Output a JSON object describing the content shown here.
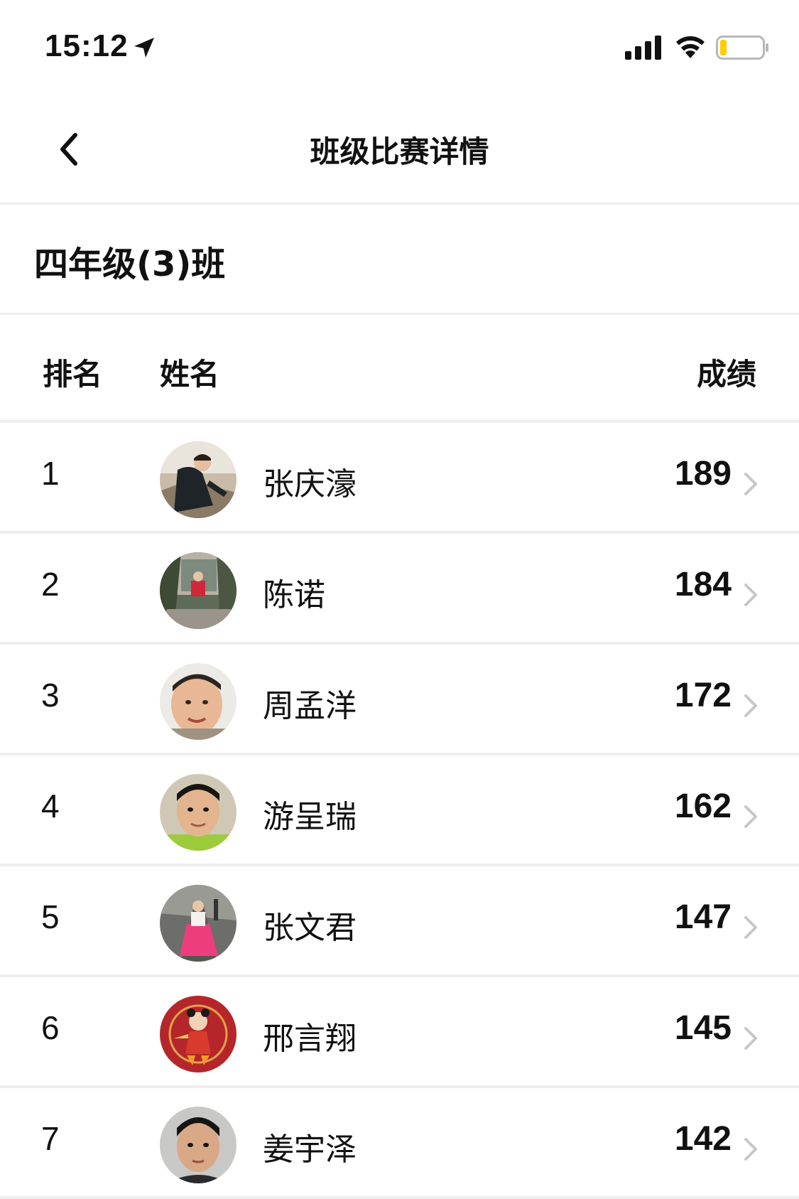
{
  "status_bar": {
    "time": "15:12",
    "icons": [
      "location-arrow-icon",
      "signal-icon",
      "wifi-icon",
      "battery-icon"
    ],
    "battery_level_fraction": 0.15,
    "battery_color": "#ffcc00"
  },
  "nav": {
    "title": "班级比赛详情",
    "back_icon": "chevron-left-icon"
  },
  "class_name": "四年级(3)班",
  "table": {
    "headers": {
      "rank": "排名",
      "name": "姓名",
      "score": "成绩"
    },
    "rows": [
      {
        "rank": "1",
        "name": "张庆濠",
        "score": "189",
        "avatar": "photo-boy-outdoors"
      },
      {
        "rank": "2",
        "name": "陈诺",
        "score": "184",
        "avatar": "photo-girl-trees"
      },
      {
        "rank": "3",
        "name": "周孟洋",
        "score": "172",
        "avatar": "photo-boy-selfie"
      },
      {
        "rank": "4",
        "name": "游呈瑞",
        "score": "162",
        "avatar": "photo-boy-portrait"
      },
      {
        "rank": "5",
        "name": "张文君",
        "score": "147",
        "avatar": "photo-girl-pink-dress"
      },
      {
        "rank": "6",
        "name": "邢言翔",
        "score": "145",
        "avatar": "cartoon-nezha-red"
      },
      {
        "rank": "7",
        "name": "姜宇泽",
        "score": "142",
        "avatar": "photo-boy-id"
      }
    ]
  },
  "colors": {
    "divider": "#eeeeee",
    "text": "#111111",
    "chevron": "#c7c7c7"
  }
}
